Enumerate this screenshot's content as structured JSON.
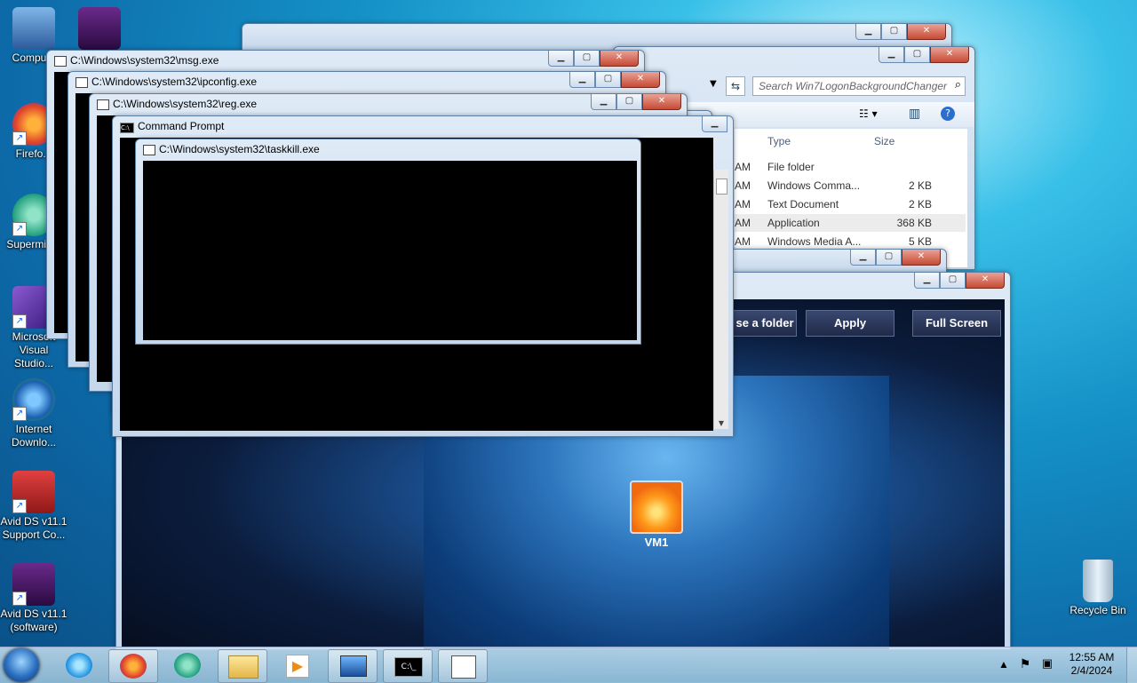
{
  "desktop": {
    "icons": [
      {
        "label": "Compu..."
      },
      {
        "label": "Firefo..."
      },
      {
        "label": "Supermium"
      },
      {
        "label": "Microsoft Visual Studio..."
      },
      {
        "label": "Internet Downlo..."
      },
      {
        "label": "Avid DS v11.1 Support Co..."
      },
      {
        "label": "Avid DS v11.1 (software)"
      },
      {
        "label": "Recycle Bin"
      }
    ]
  },
  "windows": {
    "msg": {
      "title": "C:\\Windows\\system32\\msg.exe"
    },
    "ipconfig": {
      "title": "C:\\Windows\\system32\\ipconfig.exe"
    },
    "reg": {
      "title": "C:\\Windows\\system32\\reg.exe"
    },
    "cmd": {
      "title": "Command Prompt"
    },
    "taskkill": {
      "title": "C:\\Windows\\system32\\taskkill.exe"
    },
    "explorer": {
      "search_placeholder": "Search Win7LogonBackgroundChanger",
      "col_type": "Type",
      "col_size": "Size",
      "rows": [
        {
          "time": "AM",
          "type": "File folder",
          "size": ""
        },
        {
          "time": "AM",
          "type": "Windows Comma...",
          "size": "2 KB"
        },
        {
          "time": "AM",
          "type": "Text Document",
          "size": "2 KB"
        },
        {
          "time": "AM",
          "type": "Application",
          "size": "368 KB"
        },
        {
          "time": "AM",
          "type": "Windows Media A...",
          "size": "5 KB"
        }
      ]
    },
    "logon_changer": {
      "choose_folder": "se a folder",
      "apply": "Apply",
      "full_screen": "Full Screen",
      "user_name": "VM1"
    }
  },
  "taskbar": {
    "clock_time": "12:55 AM",
    "clock_date": "2/4/2024"
  }
}
